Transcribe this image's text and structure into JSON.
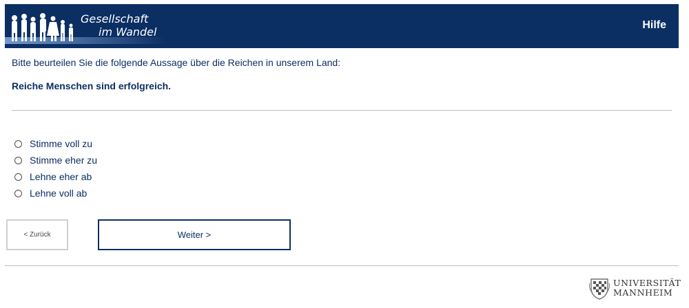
{
  "header": {
    "logo_line1": "Gesellschaft",
    "logo_line2": "im Wandel",
    "help_label": "Hilfe",
    "bg_color": "#0b2e63"
  },
  "question": {
    "intro": "Bitte beurteilen Sie die folgende Aussage über die Reichen in unserem Land:",
    "statement": "Reiche Menschen sind erfolgreich."
  },
  "options": [
    {
      "label": "Stimme voll zu"
    },
    {
      "label": "Stimme eher zu"
    },
    {
      "label": "Lehne eher ab"
    },
    {
      "label": "Lehne voll ab"
    }
  ],
  "nav": {
    "back_label": "< Zurück",
    "next_label": "Weiter >"
  },
  "footer": {
    "uni_line1": "UNIVERSITÄT",
    "uni_line2": "MANNHEIM"
  }
}
